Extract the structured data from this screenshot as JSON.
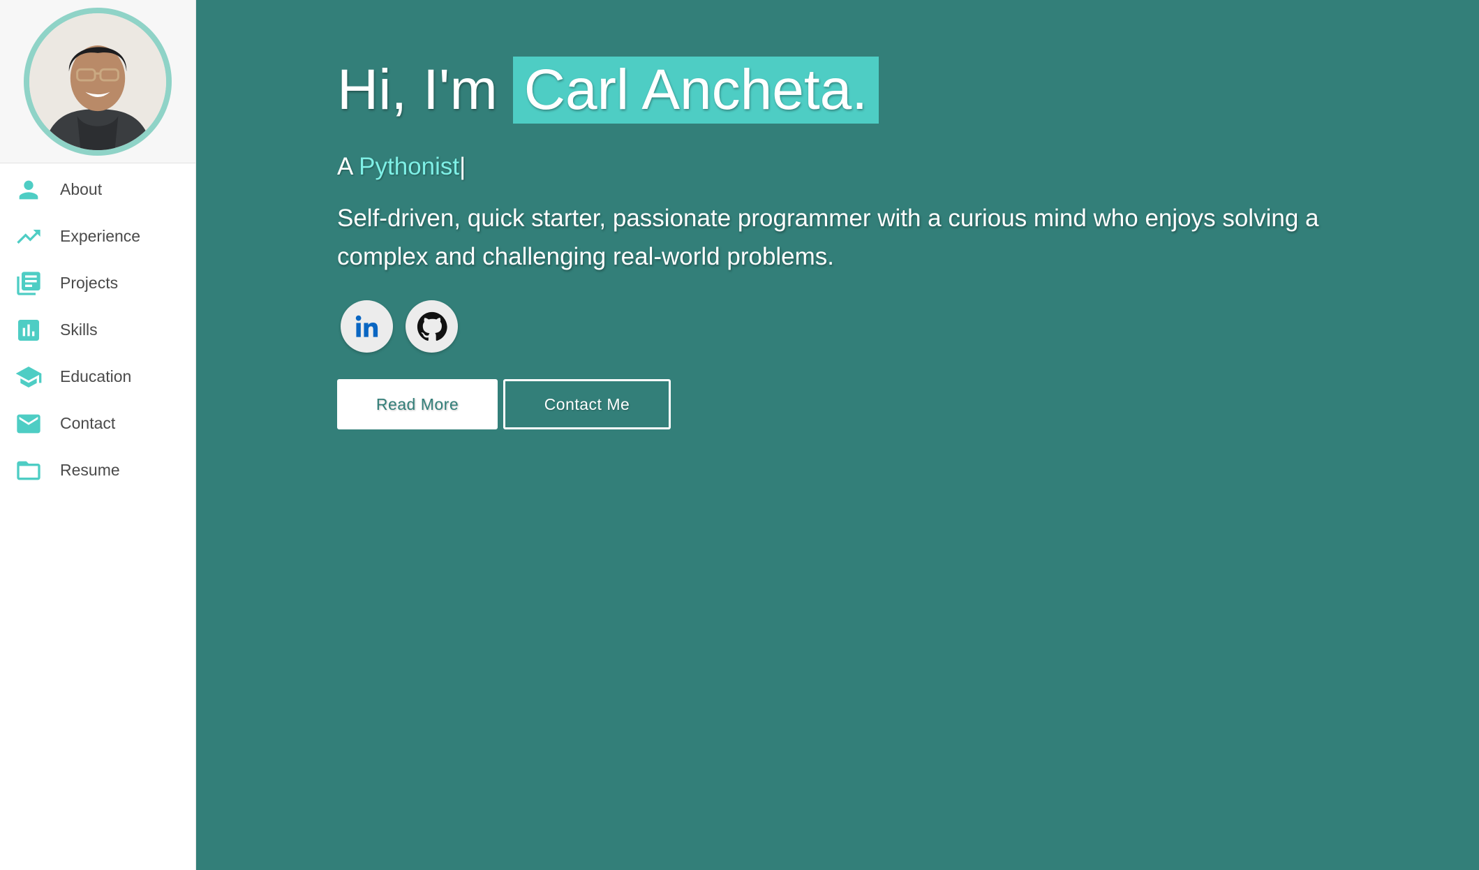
{
  "sidebar": {
    "avatar_alt": "Profile photo",
    "items": [
      {
        "label": "About",
        "icon": "person-icon"
      },
      {
        "label": "Experience",
        "icon": "trending-up-icon"
      },
      {
        "label": "Projects",
        "icon": "library-books-icon"
      },
      {
        "label": "Skills",
        "icon": "bar-chart-icon"
      },
      {
        "label": "Education",
        "icon": "graduation-cap-icon"
      },
      {
        "label": "Contact",
        "icon": "mail-icon"
      },
      {
        "label": "Resume",
        "icon": "folder-icon"
      }
    ]
  },
  "hero": {
    "greeting": "Hi, I'm",
    "name": "Carl Ancheta.",
    "role_prefix": "A",
    "role_word": "Pythonist",
    "cursor": "|",
    "bio": "Self-driven, quick starter, passionate programmer with a curious mind who enjoys solving a complex and challenging real-world problems."
  },
  "socials": {
    "linkedin_icon": "linkedin-icon",
    "github_icon": "github-icon"
  },
  "buttons": {
    "read_more": "Read More",
    "contact_me": "Contact Me"
  },
  "colors": {
    "main_bg": "#337f79",
    "accent": "#4ecdc4",
    "role_highlight": "#7ef0e6",
    "avatar_ring": "#8fd3c7",
    "nav_text": "#4a4a4a"
  }
}
